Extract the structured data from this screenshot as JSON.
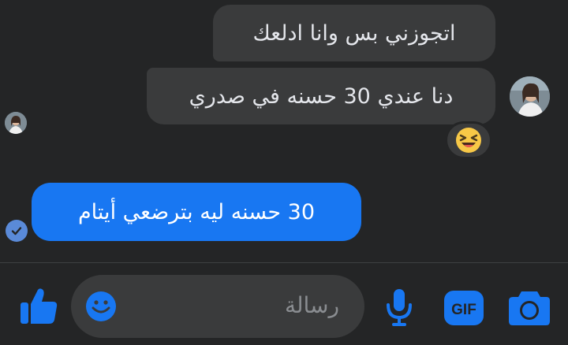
{
  "messages": [
    {
      "sender": "other",
      "text": "اتجوزني بس وانا ادلعك"
    },
    {
      "sender": "other",
      "text": "دنا عندي 30 حسنه في صدري"
    },
    {
      "sender": "me",
      "text": "30 حسنه ليه بترضعي أيتام"
    }
  ],
  "reaction": {
    "emoji": "😆"
  },
  "composer": {
    "placeholder": "رسالة"
  },
  "icons": [
    "like-icon",
    "emoji-icon",
    "microphone-icon",
    "gif-icon",
    "camera-icon",
    "seen-check-icon"
  ],
  "colors": {
    "background": "#242526",
    "incoming_bubble": "#3a3b3c",
    "outgoing_bubble": "#1877f2",
    "accent": "#1877f2"
  }
}
